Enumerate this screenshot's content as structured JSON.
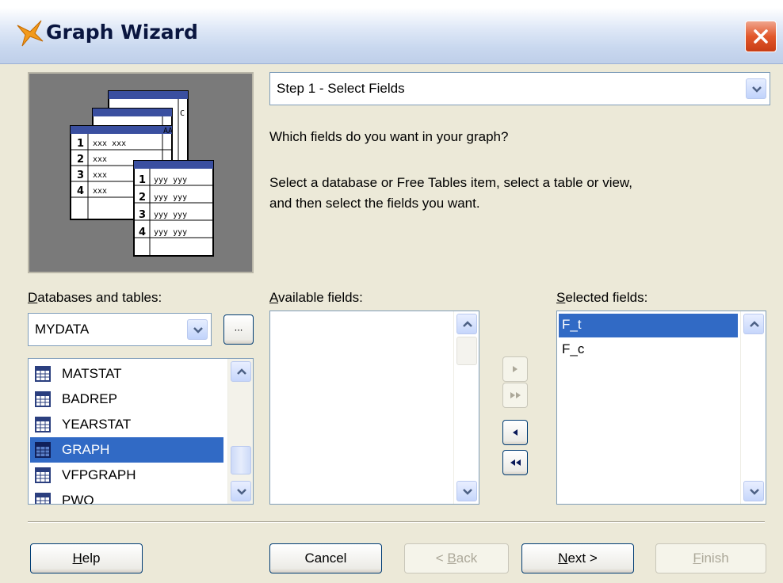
{
  "window": {
    "title": "Graph Wizard",
    "close_icon": "close-icon",
    "app_icon": "graph-wizard-icon"
  },
  "step": {
    "selected": "Step 1 - Select Fields"
  },
  "instructions": {
    "question": "Which fields do you want in your graph?",
    "detail_line1": "Select a database or Free Tables item, select a table or view,",
    "detail_line2": "and then select the fields you want."
  },
  "preview": {
    "back_rows": [
      "1",
      "2",
      "3",
      "4"
    ],
    "back_cells": [
      "xxx xxx",
      "xxx",
      "xxx",
      "xxx"
    ],
    "front_rows": [
      "1",
      "2",
      "3",
      "4"
    ],
    "front_cells": [
      "yyy yyy",
      "yyy yyy",
      "yyy yyy",
      "yyy yyy"
    ],
    "edge_aa": "AA",
    "edge_c": "C"
  },
  "databases": {
    "label_prefix": "D",
    "label_rest": "atabases and tables:",
    "selected": "MYDATA",
    "browse_label": "...",
    "tables": [
      {
        "name": "MATSTAT",
        "selected": false
      },
      {
        "name": "BADREP",
        "selected": false
      },
      {
        "name": "YEARSTAT",
        "selected": false
      },
      {
        "name": "GRAPH",
        "selected": true
      },
      {
        "name": "VFPGRAPH",
        "selected": false
      },
      {
        "name": "PWQ",
        "selected": false
      }
    ]
  },
  "available": {
    "label_prefix": "A",
    "label_rest": "vailable fields:",
    "items": []
  },
  "selected_fields": {
    "label_prefix": "S",
    "label_rest": "elected fields:",
    "items": [
      {
        "name": "F_t",
        "selected": true
      },
      {
        "name": "F_c",
        "selected": false
      }
    ]
  },
  "move_buttons": {
    "add_one": {
      "icon": "arrow-right-icon",
      "enabled": false
    },
    "add_all": {
      "icon": "double-arrow-right-icon",
      "enabled": false
    },
    "remove_one": {
      "icon": "arrow-left-icon",
      "enabled": true
    },
    "remove_all": {
      "icon": "double-arrow-left-icon",
      "enabled": true
    }
  },
  "footer": {
    "help_u": "H",
    "help_rest": "elp",
    "cancel": "Cancel",
    "back_pre": "< ",
    "back_u": "B",
    "back_rest": "ack",
    "next_u": "N",
    "next_rest": "ext >",
    "finish_u": "F",
    "finish_rest": "inish"
  },
  "colors": {
    "selection": "#316ac5",
    "face": "#ece9d8",
    "border": "#7f9db9"
  }
}
